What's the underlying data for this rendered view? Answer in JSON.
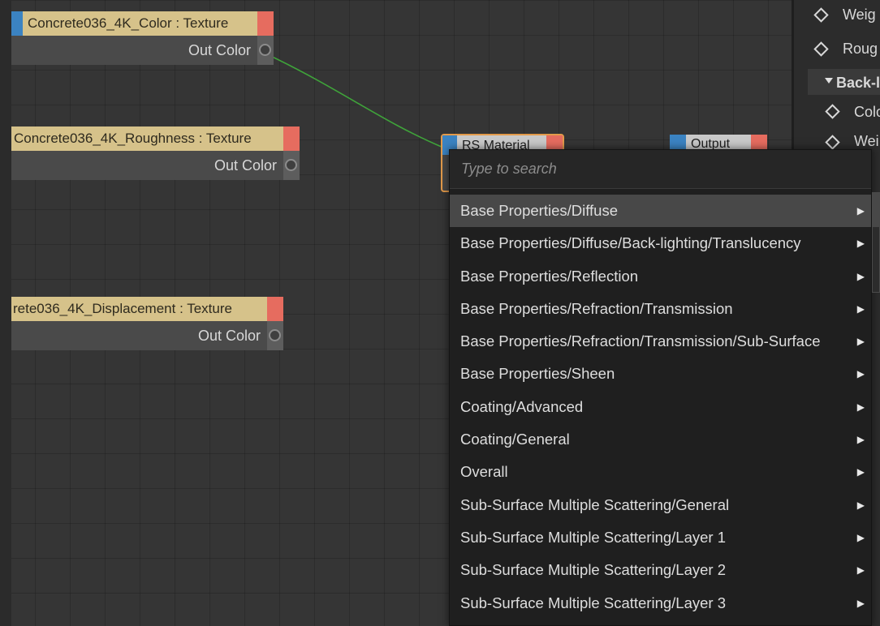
{
  "nodes": {
    "color_texture": {
      "title": "Concrete036_4K_Color : Texture",
      "output": "Out Color"
    },
    "roughness_texture": {
      "title": "Concrete036_4K_Roughness : Texture",
      "output": "Out Color"
    },
    "displacement_texture": {
      "title": "rete036_4K_Displacement : Texture",
      "output": "Out Color"
    },
    "rs_material": {
      "title": "RS Material"
    },
    "output": {
      "title": "Output"
    }
  },
  "popup": {
    "search_placeholder": "Type to search",
    "items": [
      {
        "label": "Base Properties/Diffuse"
      },
      {
        "label": "Base Properties/Diffuse/Back-lighting/Translucency"
      },
      {
        "label": "Base Properties/Reflection"
      },
      {
        "label": "Base Properties/Refraction/Transmission"
      },
      {
        "label": "Base Properties/Refraction/Transmission/Sub-Surface"
      },
      {
        "label": "Base Properties/Sheen"
      },
      {
        "label": "Coating/Advanced"
      },
      {
        "label": "Coating/General"
      },
      {
        "label": "Overall"
      },
      {
        "label": "Sub-Surface Multiple Scattering/General"
      },
      {
        "label": "Sub-Surface Multiple Scattering/Layer 1"
      },
      {
        "label": "Sub-Surface Multiple Scattering/Layer 2"
      },
      {
        "label": "Sub-Surface Multiple Scattering/Layer 3"
      }
    ],
    "highlighted_index": 0,
    "submenu_arrow": "▶"
  },
  "panel": {
    "props": [
      {
        "label": "Weig"
      },
      {
        "label": "Roug"
      },
      {
        "label": "Back-l"
      },
      {
        "label": "Colo"
      },
      {
        "label": "Wei"
      }
    ]
  },
  "colors": {
    "texture_header": "#d6c28a",
    "input_pin": "#3b83c2",
    "output_pin": "#e66c5f",
    "wire": "#3fa33a",
    "selection_border": "#e39a4a"
  }
}
